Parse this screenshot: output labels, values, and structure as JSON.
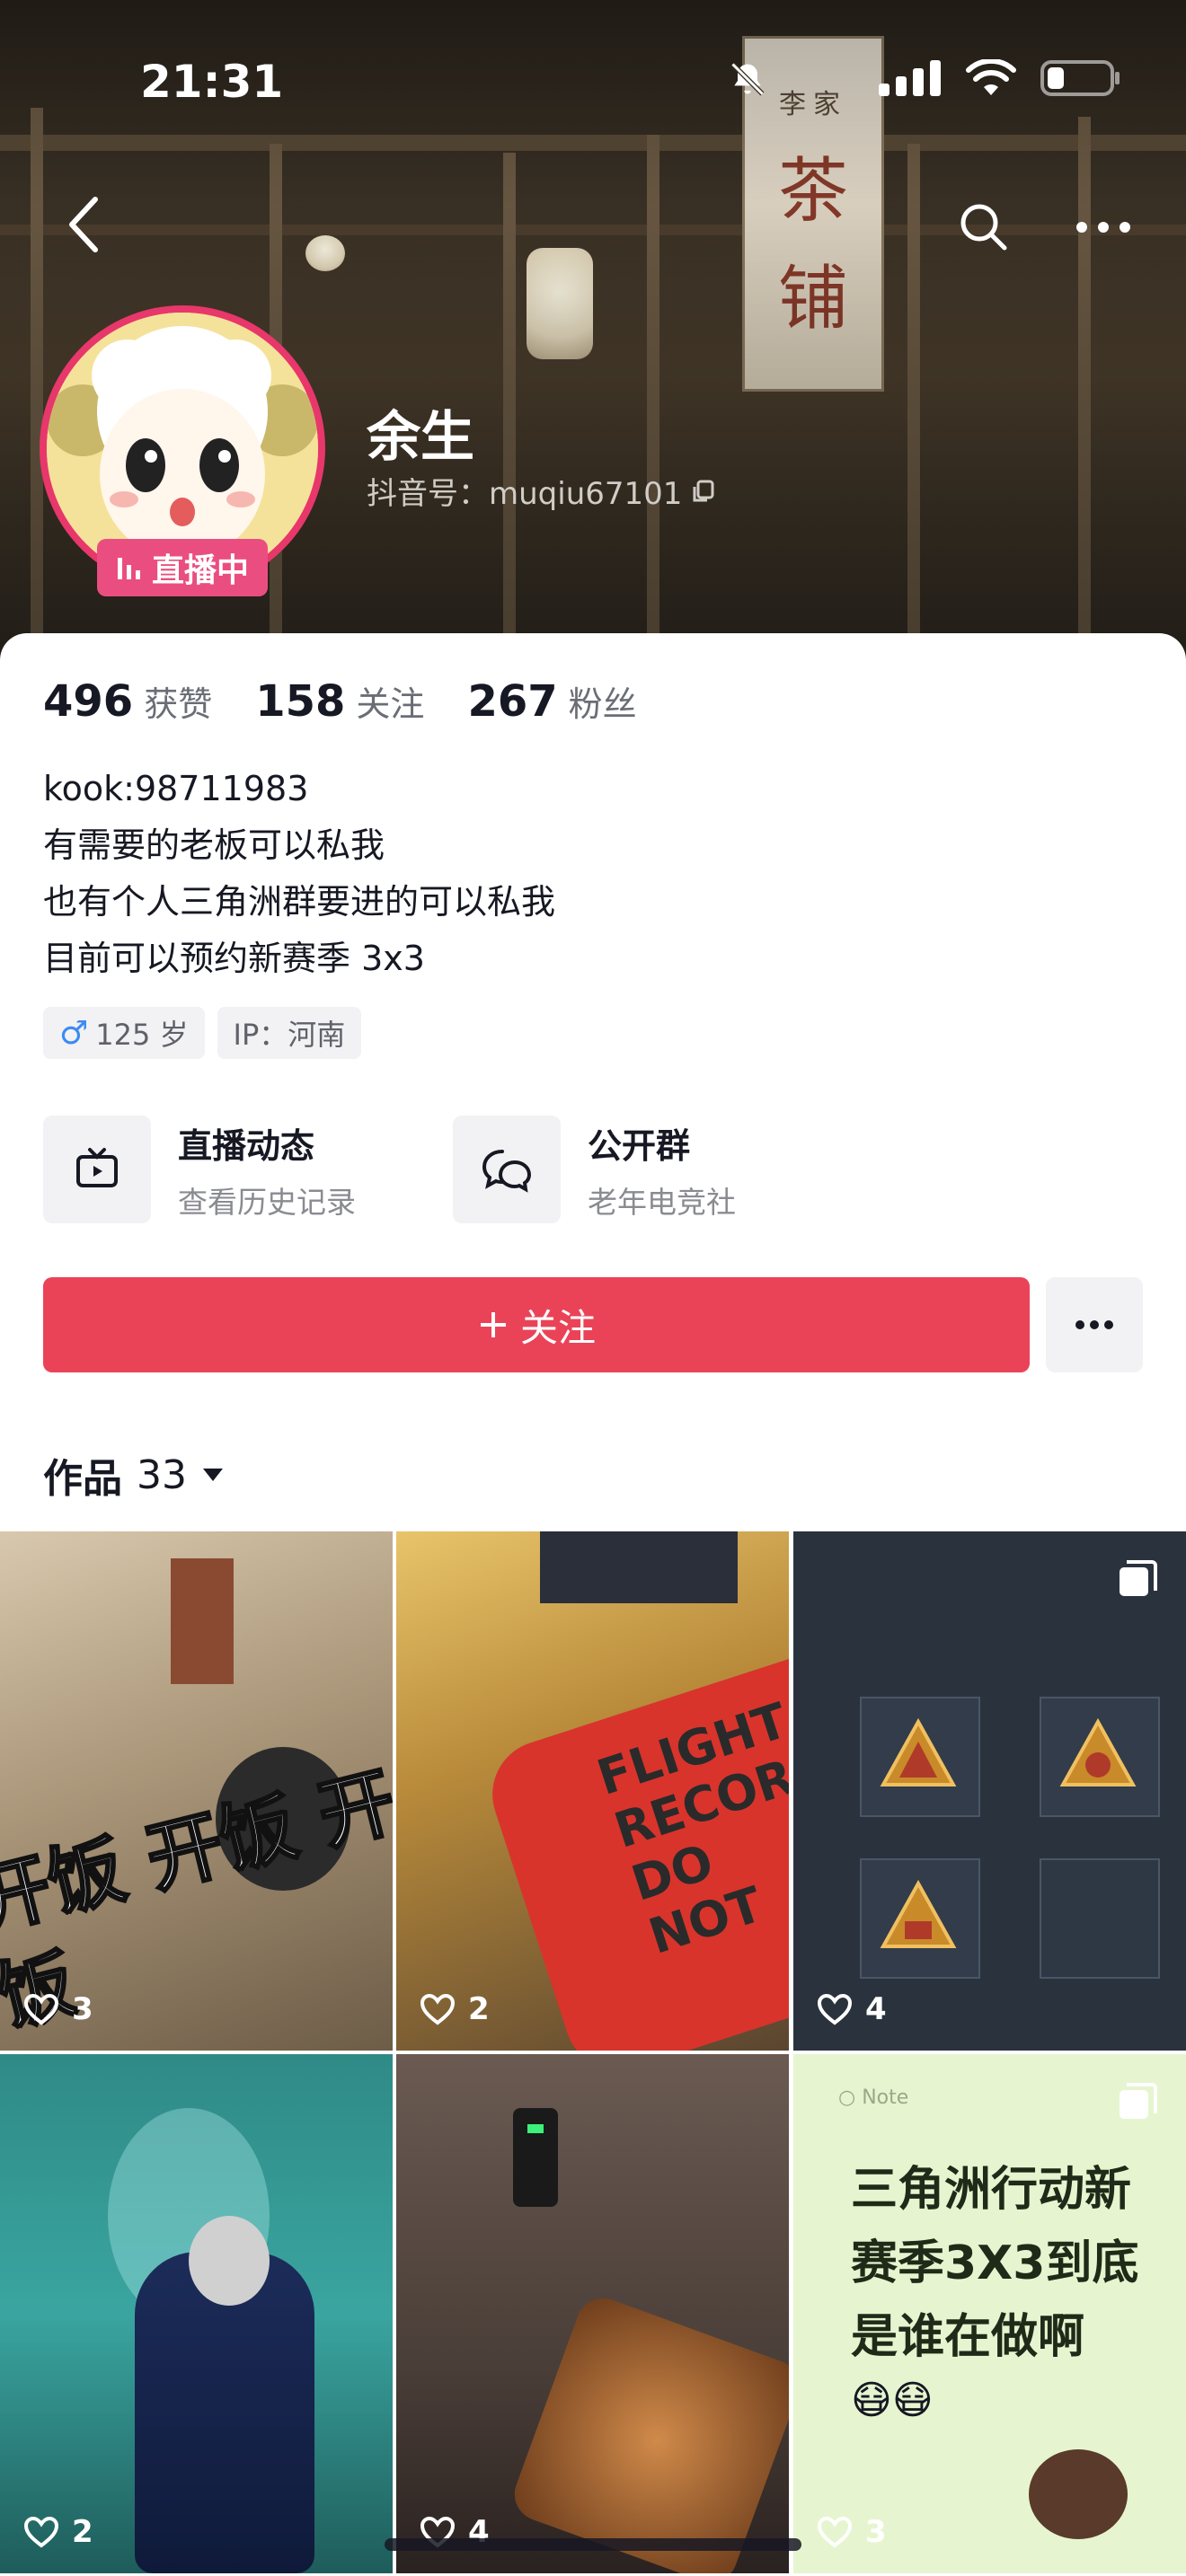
{
  "status_bar": {
    "time": "21:31"
  },
  "banner": {
    "small": "李家",
    "big_1": "茶",
    "big_2": "铺"
  },
  "profile": {
    "nickname": "余生",
    "douyin_id": "抖音号：muqiu67101",
    "live_badge": "直播中"
  },
  "stats": [
    {
      "num": "496",
      "label": "获赞"
    },
    {
      "num": "158",
      "label": "关注"
    },
    {
      "num": "267",
      "label": "粉丝"
    }
  ],
  "bio": [
    "kook:98711983",
    "有需要的老板可以私我",
    "也有个人三角洲群要进的可以私我",
    "目前可以预约新赛季 3x3"
  ],
  "tags": {
    "gender_age": "125 岁",
    "ip": "IP：河南"
  },
  "features": [
    {
      "title": "直播动态",
      "sub": "查看历史记录",
      "icon": "tv-icon"
    },
    {
      "title": "公开群",
      "sub": "老年电竞社",
      "icon": "group-chat-icon"
    }
  ],
  "actions": {
    "follow_label": "关注"
  },
  "works": {
    "label": "作品",
    "count": "33"
  },
  "tiles": [
    {
      "likes": "3",
      "overlay": "开饭 开饭 开饭"
    },
    {
      "likes": "2",
      "overlay": "FLIGHT RECORDER DO NOT"
    },
    {
      "likes": "4",
      "overlay": ""
    },
    {
      "likes": "2",
      "overlay": ""
    },
    {
      "likes": "4",
      "overlay": ""
    },
    {
      "likes": "3",
      "overlay": "三角洲行动新赛季3X3到底是谁在做啊",
      "note_label": "Note"
    }
  ],
  "colors": {
    "accent": "#ea4358",
    "live": "#ea4e80",
    "text": "#161823",
    "muted": "#8a8b91"
  }
}
